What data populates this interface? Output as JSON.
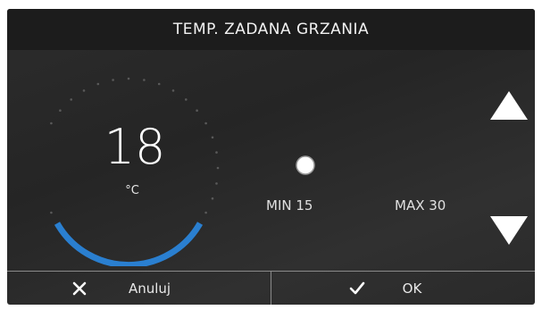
{
  "header": {
    "title": "TEMP. ZADANA GRZANIA"
  },
  "temperature": {
    "value": "18",
    "unit": "°C",
    "min": 15,
    "max": 30
  },
  "slider": {
    "min_label": "MIN 15",
    "max_label": "MAX 30",
    "value_fraction": 0.2,
    "colors": {
      "start": "#2a8fd6",
      "end": "#d0192b",
      "thumb": "#ffffff"
    }
  },
  "controls": {
    "up_icon": "triangle-up-icon",
    "down_icon": "triangle-down-icon"
  },
  "footer": {
    "cancel_label": "Anuluj",
    "cancel_icon": "close-icon",
    "ok_label": "OK",
    "ok_icon": "checkmark-icon"
  },
  "colors": {
    "accent": "#2a7fd0",
    "text": "#ffffff",
    "background": "#2a2a2a"
  }
}
